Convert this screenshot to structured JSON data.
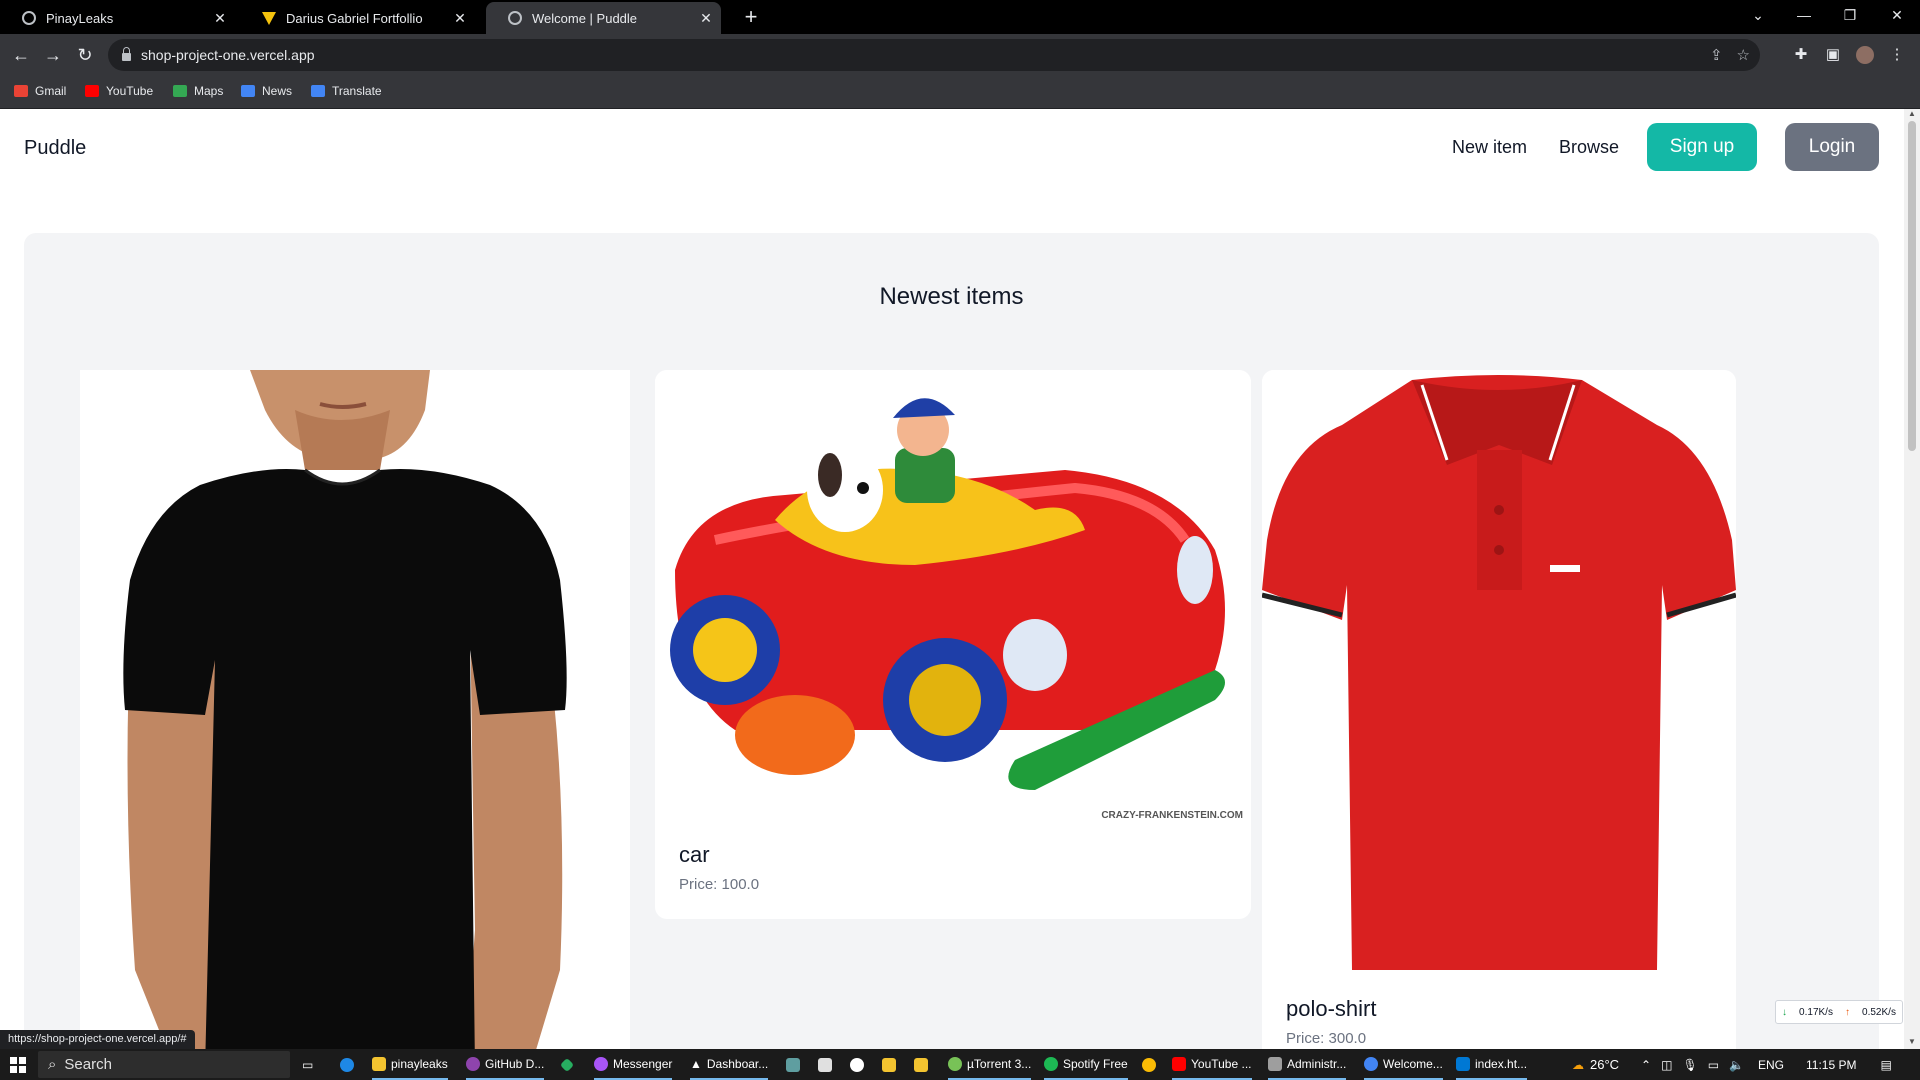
{
  "browser": {
    "tabs": [
      {
        "title": "PinayLeaks"
      },
      {
        "title": "Darius Gabriel Fortfollio"
      },
      {
        "title": "Welcome | Puddle"
      }
    ],
    "url": "shop-project-one.vercel.app",
    "bookmarks": [
      {
        "label": "Gmail",
        "color": "#ea4335"
      },
      {
        "label": "YouTube",
        "color": "#ff0000"
      },
      {
        "label": "Maps",
        "color": "#34a853"
      },
      {
        "label": "News",
        "color": "#4285f4"
      },
      {
        "label": "Translate",
        "color": "#4285f4"
      }
    ],
    "status_url": "https://shop-project-one.vercel.app/#"
  },
  "site": {
    "brand": "Puddle",
    "nav": {
      "new_item": "New item",
      "browse": "Browse",
      "signup": "Sign up",
      "login": "Login"
    },
    "accent_color": "#14b8a6",
    "section_title": "Newest items",
    "items": [
      {
        "name": "",
        "price": "",
        "image": "black-tshirt"
      },
      {
        "name": "car",
        "price": "Price: 100.0",
        "image": "toy-car",
        "watermark": "CRAZY-FRANKENSTEIN.COM"
      },
      {
        "name": "polo-shirt",
        "price": "Price: 300.0",
        "image": "red-polo-shirt"
      }
    ]
  },
  "netspeed": {
    "down": "0.17K/s",
    "up": "0.52K/s"
  },
  "taskbar": {
    "search_placeholder": "Search",
    "items": [
      {
        "label": "pinayleaks",
        "color": "#f4c430"
      },
      {
        "label": "GitHub D...",
        "color": "#8e44ad"
      },
      {
        "label": "Messenger",
        "color": "#a855f7"
      },
      {
        "label": "Dashboar...",
        "color": "#ffffff"
      },
      {
        "label": "µTorrent 3...",
        "color": "#78c257"
      },
      {
        "label": "Spotify Free",
        "color": "#1db954"
      },
      {
        "label": "YouTube ...",
        "color": "#ff0000"
      },
      {
        "label": "Administr...",
        "color": "#9e9e9e"
      },
      {
        "label": "Welcome...",
        "color": "#4285f4"
      },
      {
        "label": "index.ht...",
        "color": "#0078d4"
      }
    ],
    "weather": "26°C",
    "language": "ENG",
    "time": "11:15 PM"
  }
}
